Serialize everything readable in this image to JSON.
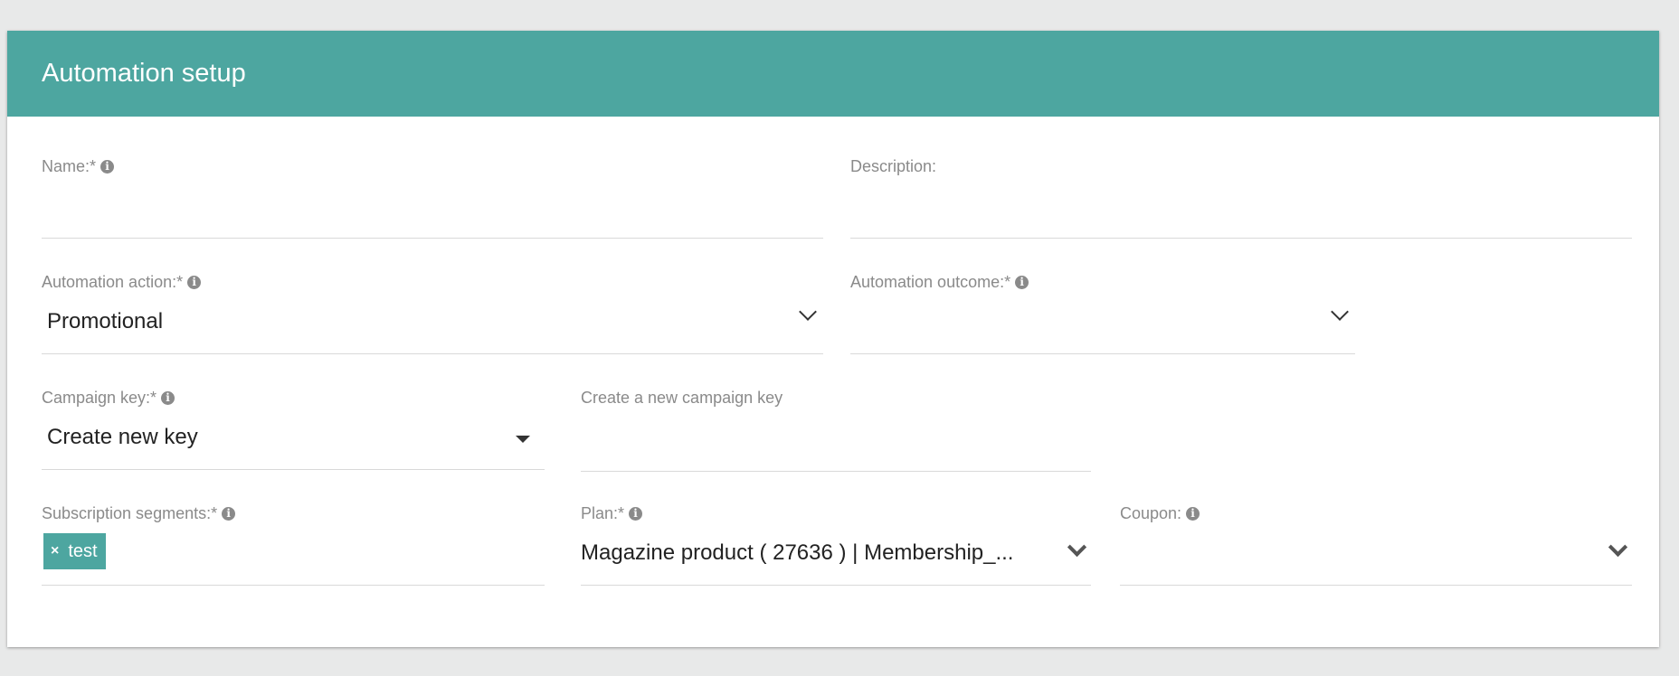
{
  "header": {
    "title": "Automation setup"
  },
  "form": {
    "name": {
      "label": "Name:*",
      "value": ""
    },
    "description": {
      "label": "Description:",
      "value": ""
    },
    "automation_action": {
      "label": "Automation action:*",
      "value": "Promotional"
    },
    "automation_outcome": {
      "label": "Automation outcome:*",
      "value": ""
    },
    "campaign_key": {
      "label": "Campaign key:*",
      "value": "Create new key"
    },
    "new_campaign_key": {
      "label": "Create a new campaign key",
      "value": ""
    },
    "subscription_segments": {
      "label": "Subscription segments:*",
      "tags": [
        "test"
      ],
      "tag_remove_glyph": "×"
    },
    "plan": {
      "label": "Plan:*",
      "value": "Magazine product ( 27636 ) | Membership_..."
    },
    "coupon": {
      "label": "Coupon:",
      "value": ""
    }
  },
  "icons": {
    "info": "i"
  },
  "colors": {
    "accent": "#4da6a0",
    "background": "#e8e9e9",
    "label": "#8a8a8a"
  }
}
